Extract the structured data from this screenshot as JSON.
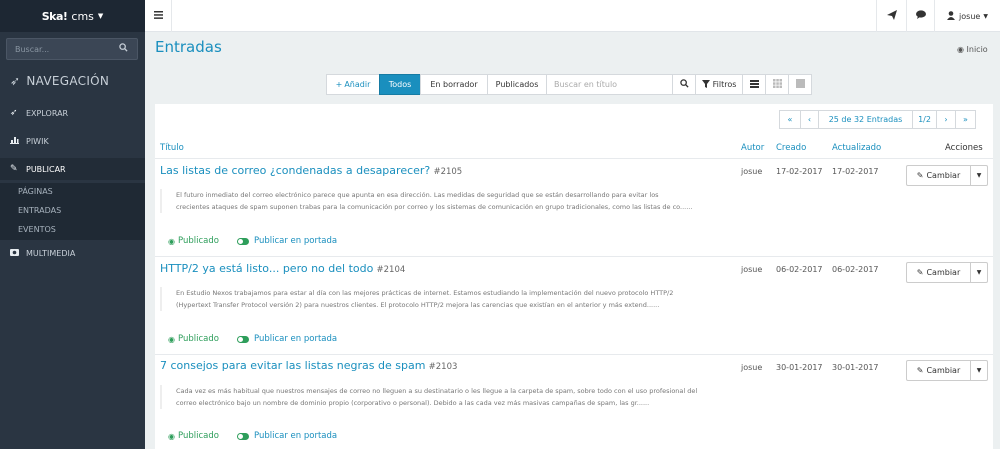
{
  "sidebar": {
    "brand": {
      "logo": "Ska!",
      "name": "cms"
    },
    "search_placeholder": "Buscar...",
    "nav_heading": "NAVEGACIÓN",
    "items": [
      {
        "label": "EXPLORAR",
        "icon": "rocket-icon"
      },
      {
        "label": "PIWIK",
        "icon": "chart-icon"
      },
      {
        "label": "PUBLICAR",
        "icon": "pencil-icon"
      },
      {
        "label": "MULTIMEDIA",
        "icon": "camera-icon"
      }
    ],
    "subitems": [
      "PÁGINAS",
      "ENTRADAS",
      "EVENTOS"
    ]
  },
  "topbar": {
    "user": "josue"
  },
  "page": {
    "title": "Entradas",
    "breadcrumb": "Inicio"
  },
  "toolbar": {
    "add": "Añadir",
    "filters": [
      "Todos",
      "En borrador",
      "Publicados"
    ],
    "search_placeholder": "Buscar en título",
    "filtros": "Filtros"
  },
  "pager": {
    "summary": "25 de 32 Entradas",
    "page": "1/2"
  },
  "table": {
    "headers": {
      "title": "Título",
      "author": "Autor",
      "created": "Creado",
      "updated": "Actualizado",
      "actions": "Acciones"
    },
    "action_label": "Cambiar",
    "status_label": "Publicado",
    "portada_label": "Publicar en portada",
    "rows": [
      {
        "title": "Las listas de correo ¿condenadas a desaparecer?",
        "id": "#2105",
        "excerpt_1": "El futuro inmediato del correo electrónico parece que apunta en esa dirección. Las medidas de seguridad que se están desarrollando para evitar los",
        "excerpt_2": "crecientes ataques de spam suponen trabas para la comunicación por correo y los sistemas de comunicación en grupo tradicionales, como las listas de co......",
        "author": "josue",
        "created": "17-02-2017",
        "updated": "17-02-2017"
      },
      {
        "title": "HTTP/2 ya está listo... pero no del todo",
        "id": "#2104",
        "excerpt_1": "En Estudio Nexos trabajamos para estar al día con las mejores prácticas de internet. Estamos estudiando la implementación del nuevo protocolo HTTP/2",
        "excerpt_2": "(Hypertext Transfer Protocol versión 2) para nuestros clientes. El protocolo HTTP/2 mejora las carencias que existían en el anterior y más extend......",
        "author": "josue",
        "created": "06-02-2017",
        "updated": "06-02-2017"
      },
      {
        "title": "7 consejos para evitar las listas negras de spam",
        "id": "#2103",
        "excerpt_1": "Cada vez es más habitual que nuestros mensajes de correo no lleguen a su destinatario o les llegue a la carpeta de spam, sobre todo con el uso profesional del",
        "excerpt_2": "correo electrónico bajo un nombre de dominio propio (corporativo o personal). Debido a las cada vez más masivas campañas de spam, las gr......",
        "author": "josue",
        "created": "30-01-2017",
        "updated": "30-01-2017"
      }
    ]
  }
}
